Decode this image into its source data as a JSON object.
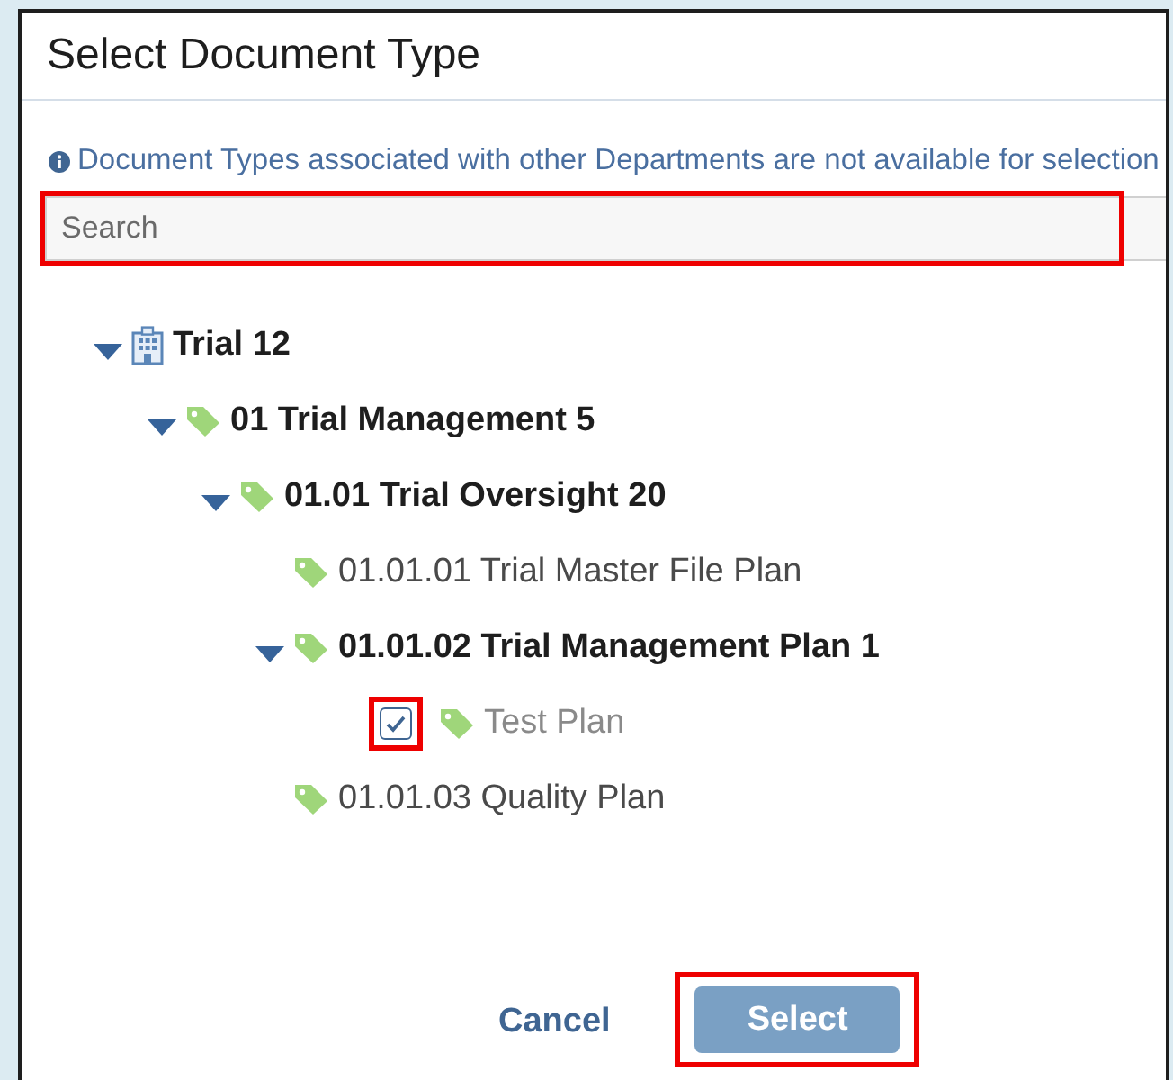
{
  "dialog": {
    "title": "Select Document Type",
    "info": "Document Types associated with other Departments are not available for selection",
    "search": {
      "placeholder": "Search"
    },
    "tree": [
      {
        "label": "Trial 12",
        "kind": "building",
        "expanded": true,
        "children": [
          {
            "label": "01 Trial Management 5",
            "kind": "tag",
            "expanded": true,
            "children": [
              {
                "label": "01.01 Trial Oversight 20",
                "kind": "tag",
                "expanded": true,
                "children": [
                  {
                    "label": "01.01.01 Trial Master File Plan",
                    "kind": "tag"
                  },
                  {
                    "label": "01.01.02 Trial Management Plan 1",
                    "kind": "tag",
                    "expanded": true,
                    "children": [
                      {
                        "label": "Test Plan",
                        "kind": "tag",
                        "checked": true
                      }
                    ]
                  },
                  {
                    "label": "01.01.03 Quality Plan",
                    "kind": "tag"
                  }
                ]
              }
            ]
          }
        ]
      }
    ],
    "buttons": [
      {
        "label": "Cancel",
        "kind": "link"
      },
      {
        "label": "Select",
        "kind": "primary"
      }
    ]
  }
}
